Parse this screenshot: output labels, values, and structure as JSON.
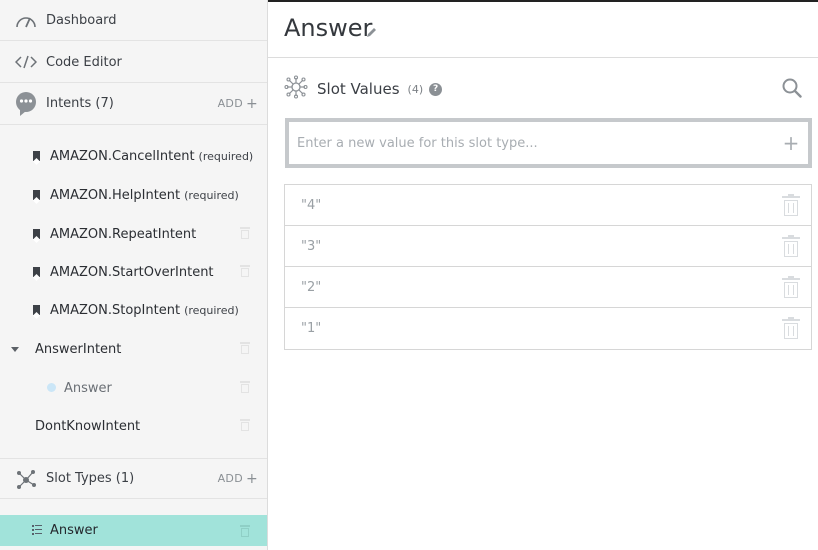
{
  "sidebar": {
    "dashboard_label": "Dashboard",
    "code_editor_label": "Code Editor",
    "intents_header": "Intents (7)",
    "intents_add": "ADD",
    "intents": [
      {
        "name": "AMAZON.CancelIntent",
        "tag": "(required)"
      },
      {
        "name": "AMAZON.HelpIntent",
        "tag": "(required)"
      },
      {
        "name": "AMAZON.RepeatIntent",
        "tag": ""
      },
      {
        "name": "AMAZON.StartOverIntent",
        "tag": ""
      },
      {
        "name": "AMAZON.StopIntent",
        "tag": "(required)"
      }
    ],
    "custom_intent": "AnswerIntent",
    "custom_intent_slot": "Answer",
    "other_intent": "DontKnowIntent",
    "slot_types_header": "Slot Types (1)",
    "slot_types_add": "ADD",
    "selected_slot_type": "Answer"
  },
  "main": {
    "title": "Answer",
    "section_title": "Slot Values",
    "section_count": "(4)",
    "input_placeholder": "Enter a new value for this slot type...",
    "values": [
      "\"4\"",
      "\"3\"",
      "\"2\"",
      "\"1\""
    ]
  },
  "colors": {
    "selected_bg": "#a1e3da",
    "sidebar_bg": "#f5f5f5"
  }
}
